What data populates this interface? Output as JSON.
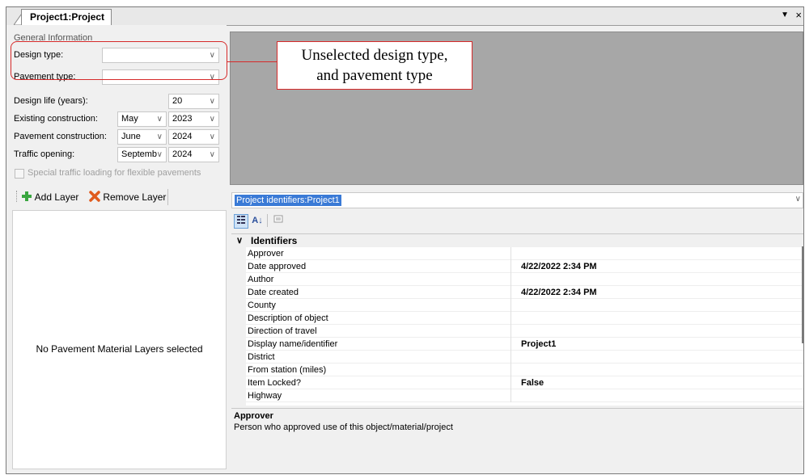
{
  "tab": {
    "label": "Project1:Project"
  },
  "general": {
    "group_label": "General Information",
    "design_type_label": "Design type:",
    "design_type_value": "",
    "pavement_type_label": "Pavement type:",
    "pavement_type_value": "",
    "design_life_label": "Design life (years):",
    "design_life_value": "20",
    "existing_label": "Existing construction:",
    "existing_month": "May",
    "existing_year": "2023",
    "pavement_label": "Pavement construction:",
    "pavement_month": "June",
    "pavement_year": "2024",
    "traffic_label": "Traffic opening:",
    "traffic_month": "Septemb",
    "traffic_year": "2024",
    "special_checkbox_label": "Special traffic loading for flexible pavements",
    "special_checkbox_checked": false
  },
  "callout": {
    "line1": "Unselected design type,",
    "line2": "and pavement type"
  },
  "layers": {
    "add_label": "Add Layer",
    "remove_label": "Remove Layer",
    "empty_message": "No Pavement Material Layers selected"
  },
  "properties": {
    "selector_value": "Project identifiers:Project1",
    "category": "Identifiers",
    "rows": [
      {
        "name": "Approver",
        "value": ""
      },
      {
        "name": "Date approved",
        "value": "4/22/2022 2:34 PM"
      },
      {
        "name": "Author",
        "value": ""
      },
      {
        "name": "Date created",
        "value": "4/22/2022 2:34 PM"
      },
      {
        "name": "County",
        "value": ""
      },
      {
        "name": "Description of object",
        "value": ""
      },
      {
        "name": "Direction of travel",
        "value": ""
      },
      {
        "name": "Display name/identifier",
        "value": "Project1"
      },
      {
        "name": "District",
        "value": ""
      },
      {
        "name": "From station (miles)",
        "value": ""
      },
      {
        "name": "Item Locked?",
        "value": "False"
      },
      {
        "name": "Highway",
        "value": ""
      }
    ],
    "help_title": "Approver",
    "help_text": "Person who approved use of this object/material/project"
  },
  "colors": {
    "callout_red": "#d62a2a",
    "selection_blue": "#3a7ad6",
    "canvas_gray": "#a7a7a7"
  },
  "icons": [
    "add-layer-icon",
    "remove-layer-icon",
    "categorized-icon",
    "sort-alpha-icon",
    "property-pages-icon",
    "chevron-down-icon",
    "close-icon"
  ]
}
